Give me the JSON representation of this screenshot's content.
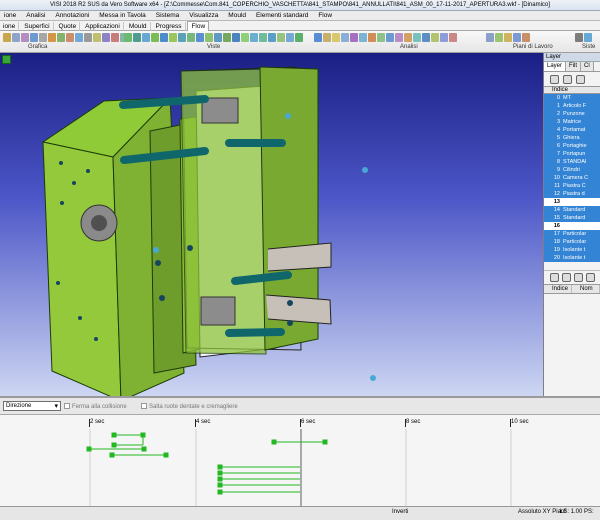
{
  "window": {
    "title": "VISI 2018 R2 SUS da Vero Software x64 - [Z:\\Commesse\\Com.841_COPERCHIO_VASCHETTA\\841_STAMPO\\841_ANNULLATI\\841_ASM_00_17-11-2017_APERTURA3.wkf - [Dinamico]"
  },
  "menu": [
    "ione",
    "Analisi",
    "Annotazioni",
    "Messa in Tavola",
    "Sistema",
    "Visualizza",
    "Mould",
    "Elementi standard",
    "Flow"
  ],
  "tabs": [
    "ione",
    "Superfici",
    "Quote",
    "Applicazioni",
    "Mould",
    "Progress",
    "Flow"
  ],
  "ribbon_groups": [
    "Grafica",
    "Viste",
    "Analisi",
    "Piani di Lavoro",
    "Siste"
  ],
  "layer_panel": {
    "title": "Layer",
    "tabs": [
      "Layer",
      "Filt",
      "Cl"
    ],
    "header": "Indice",
    "rows": [
      {
        "num": "0",
        "name": "MT",
        "selected": true
      },
      {
        "num": "1",
        "name": "Articolo F",
        "selected": true
      },
      {
        "num": "2",
        "name": "Punzone",
        "selected": true
      },
      {
        "num": "3",
        "name": "Matrice",
        "selected": true
      },
      {
        "num": "4",
        "name": "Portamat",
        "selected": true
      },
      {
        "num": "5",
        "name": "Ghiera",
        "selected": true
      },
      {
        "num": "6",
        "name": "Portaghie",
        "selected": true
      },
      {
        "num": "7",
        "name": "Portapun",
        "selected": true
      },
      {
        "num": "8",
        "name": "STANDAI",
        "selected": true
      },
      {
        "num": "9",
        "name": "Cilindri",
        "selected": true
      },
      {
        "num": "10",
        "name": "Camera C",
        "selected": true
      },
      {
        "num": "11",
        "name": "Piastra C",
        "selected": true
      },
      {
        "num": "12",
        "name": "Piastra d",
        "selected": true
      },
      {
        "num": "13",
        "name": "",
        "selected": false
      },
      {
        "num": "14",
        "name": "Standard",
        "selected": true
      },
      {
        "num": "15",
        "name": "Standard",
        "selected": true
      },
      {
        "num": "16",
        "name": "",
        "selected": false
      },
      {
        "num": "17",
        "name": "Particolar",
        "selected": true
      },
      {
        "num": "18",
        "name": "Particolar",
        "selected": true
      },
      {
        "num": "19",
        "name": "Isolante t",
        "selected": true
      },
      {
        "num": "20",
        "name": "Isolante t",
        "selected": true
      }
    ],
    "list_header": [
      "Indice",
      "Nom"
    ]
  },
  "timeline": {
    "direction_label": "Direzione",
    "check1": "Ferma alla collisione",
    "check2": "Salta ruote dentate e cremagliere",
    "ticks": [
      "2 sec",
      "4 sec",
      "6 sec",
      "8 sec",
      "10 sec"
    ]
  },
  "status": {
    "mode": "Assoluto XY Piant",
    "inverti": "Inverti",
    "scale": "LS: 1.00 PS:"
  }
}
